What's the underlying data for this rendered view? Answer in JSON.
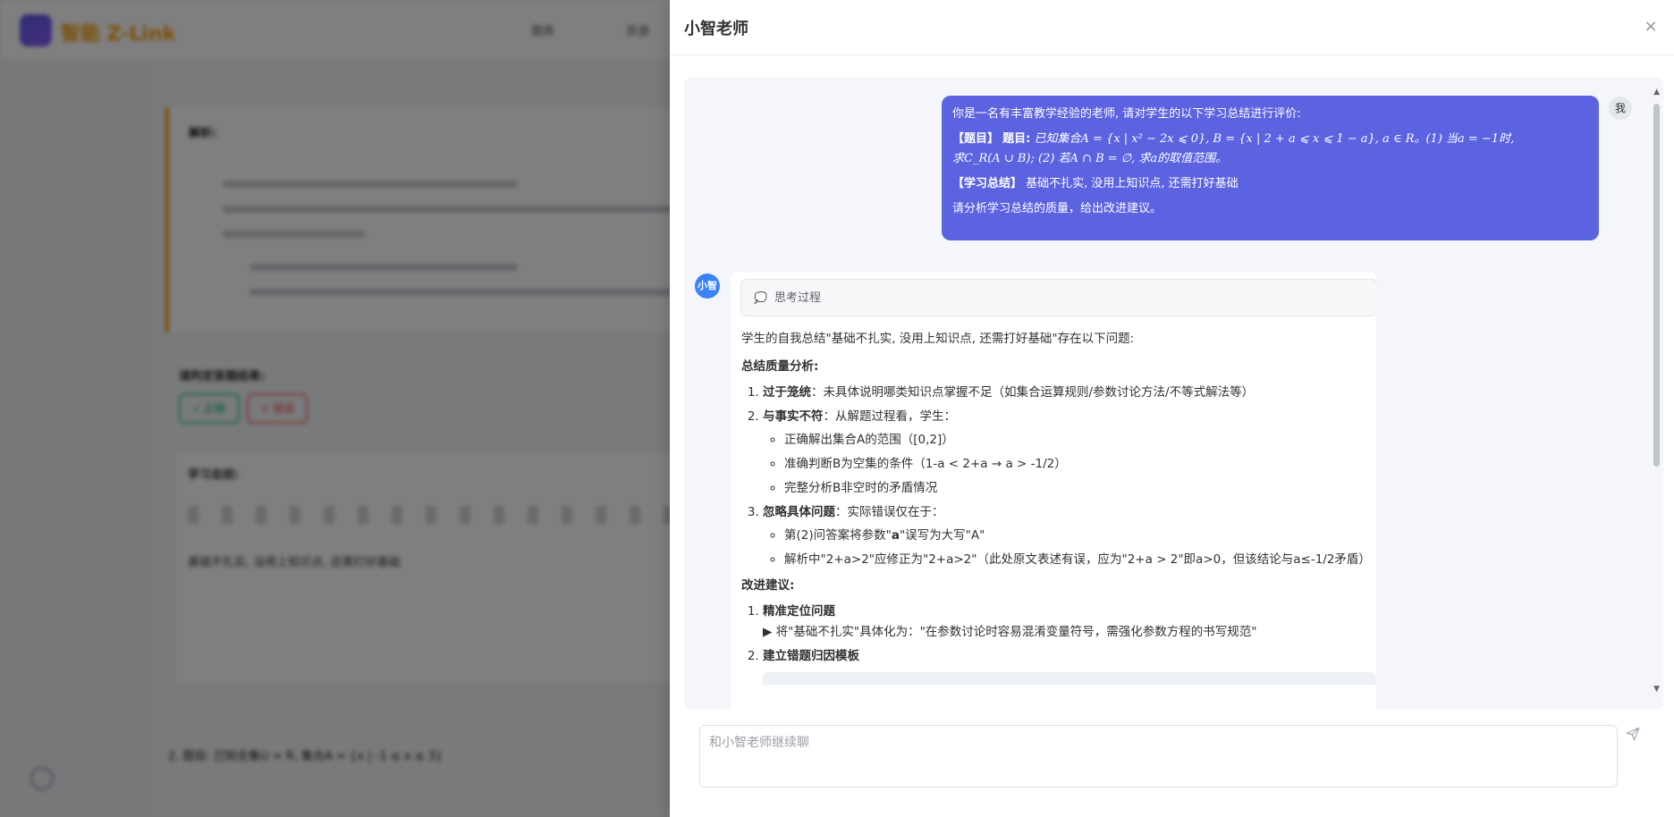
{
  "background": {
    "brand": "智能 Z-Link",
    "nav": [
      "题库",
      "资源"
    ],
    "card_title": "解析:",
    "review_label": "请判定答题结果:",
    "btn_correct": "√ 正确",
    "btn_wrong": "× 错误",
    "editor_title": "学习总结:",
    "editor_text": "基础不扎实, 没用上知识点, 还需打好基础",
    "q2_text": "2.  题目: 已知全集U = R, 集合A = {x | -1 ≤ x ≤ 3}"
  },
  "drawer": {
    "title": "小智老师",
    "close": "×"
  },
  "user_message": {
    "avatar": "我",
    "line1": "你是一名有丰富教学经验的老师, 请对学生的以下学习总结进行评价:",
    "q_tag": "【题目】",
    "q_label": "题目:",
    "q_text_a": "已知集合A = {x | x² − 2x ⩽ 0}, B = {x | 2 + a ⩽ x ⩽ 1 − a}, a ∈ R。(1) 当a = −1时,",
    "q_text_b": "求C_R(A ∪ B); (2) 若A ∩ B = ∅, 求a的取值范围。",
    "s_tag": "【学习总结】",
    "s_text": "基础不扎实, 没用上知识点, 还需打好基础",
    "line_last": "请分析学习总结的质量，给出改进建议。"
  },
  "ai_message": {
    "avatar": "小智",
    "thinking_label": "思考过程",
    "intro": "学生的自我总结\"基础不扎实, 没用上知识点, 还需打好基础\"存在以下问题:",
    "section1_title": "总结质量分析:",
    "items": [
      {
        "bold": "过于笼统",
        "text": "：未具体说明哪类知识点掌握不足（如集合运算规则/参数讨论方法/不等式解法等）"
      },
      {
        "bold": "与事实不符",
        "text": "：从解题过程看，学生："
      },
      {
        "bold": "忽略具体问题",
        "text": "：实际错误仅在于："
      }
    ],
    "sub_a": [
      "正确解出集合A的范围（[0,2]）",
      "准确判断B为空集的条件（1-a < 2+a → a > -1/2）",
      "完整分析B非空时的矛盾情况"
    ],
    "sub_b1_pre": "第(2)问答案将参数\"",
    "sub_b1_bold": "a",
    "sub_b1_post": "\"误写为大写\"A\"",
    "sub_b2": "解析中\"2+a>2\"应修正为\"2+a>2\"（此处原文表述有误，应为\"2+a > 2\"即a>0，但该结论与a≤-1/2矛盾）",
    "section2_title": "改进建议:",
    "sugg1_title": "精准定位问题",
    "sugg1_text": "▶ 将\"基础不扎实\"具体化为：\"在参数讨论时容易混淆变量符号，需强化参数方程的书写规范\"",
    "sugg2_title": "建立错题归因模板"
  },
  "input": {
    "placeholder": "和小智老师继续聊"
  },
  "colors": {
    "user_bubble": "#5b63e0",
    "ai_avatar": "#3b82f6",
    "brand": "#f59e0b"
  }
}
